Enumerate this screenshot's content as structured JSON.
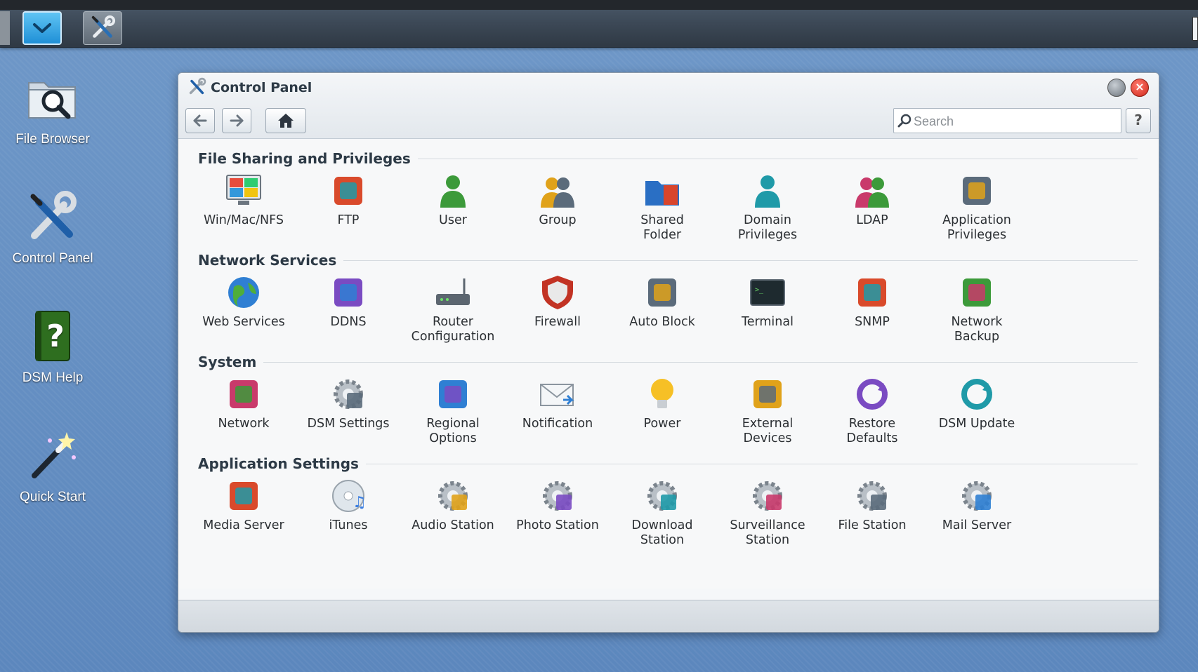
{
  "desktop": {
    "icons": [
      {
        "label": "File Browser",
        "icon": "folder-magnifier-icon"
      },
      {
        "label": "Control Panel",
        "icon": "wrench-screwdriver-icon"
      },
      {
        "label": "DSM Help",
        "icon": "help-book-icon"
      },
      {
        "label": "Quick Start",
        "icon": "magic-wand-icon"
      }
    ]
  },
  "taskbar": {
    "main_menu_icon": "chevron-down-icon",
    "task_icon": "wrench-screwdriver-icon"
  },
  "window": {
    "title": "Control Panel",
    "search_placeholder": "Search",
    "help_label": "?",
    "close_label": "×"
  },
  "sections": [
    {
      "title": "File Sharing and Privileges",
      "items": [
        {
          "line1": "Win/Mac/NFS",
          "line2": ""
        },
        {
          "line1": "FTP",
          "line2": ""
        },
        {
          "line1": "User",
          "line2": ""
        },
        {
          "line1": "Group",
          "line2": ""
        },
        {
          "line1": "Shared",
          "line2": "Folder"
        },
        {
          "line1": "Domain",
          "line2": "Privileges"
        },
        {
          "line1": "LDAP",
          "line2": ""
        },
        {
          "line1": "Application",
          "line2": "Privileges"
        }
      ]
    },
    {
      "title": "Network Services",
      "items": [
        {
          "line1": "Web Services",
          "line2": ""
        },
        {
          "line1": "DDNS",
          "line2": ""
        },
        {
          "line1": "Router",
          "line2": "Configuration"
        },
        {
          "line1": "Firewall",
          "line2": ""
        },
        {
          "line1": "Auto Block",
          "line2": ""
        },
        {
          "line1": "Terminal",
          "line2": ""
        },
        {
          "line1": "SNMP",
          "line2": ""
        },
        {
          "line1": "Network",
          "line2": "Backup"
        }
      ]
    },
    {
      "title": "System",
      "items": [
        {
          "line1": "Network",
          "line2": ""
        },
        {
          "line1": "DSM Settings",
          "line2": ""
        },
        {
          "line1": "Regional",
          "line2": "Options"
        },
        {
          "line1": "Notification",
          "line2": ""
        },
        {
          "line1": "Power",
          "line2": ""
        },
        {
          "line1": "External",
          "line2": "Devices"
        },
        {
          "line1": "Restore",
          "line2": "Defaults"
        },
        {
          "line1": "DSM Update",
          "line2": ""
        }
      ]
    },
    {
      "title": "Application Settings",
      "items": [
        {
          "line1": "Media Server",
          "line2": ""
        },
        {
          "line1": "iTunes",
          "line2": ""
        },
        {
          "line1": "Audio Station",
          "line2": ""
        },
        {
          "line1": "Photo Station",
          "line2": ""
        },
        {
          "line1": "Download",
          "line2": "Station"
        },
        {
          "line1": "Surveillance",
          "line2": "Station"
        },
        {
          "line1": "File Station",
          "line2": ""
        },
        {
          "line1": "Mail Server",
          "line2": ""
        }
      ]
    }
  ]
}
